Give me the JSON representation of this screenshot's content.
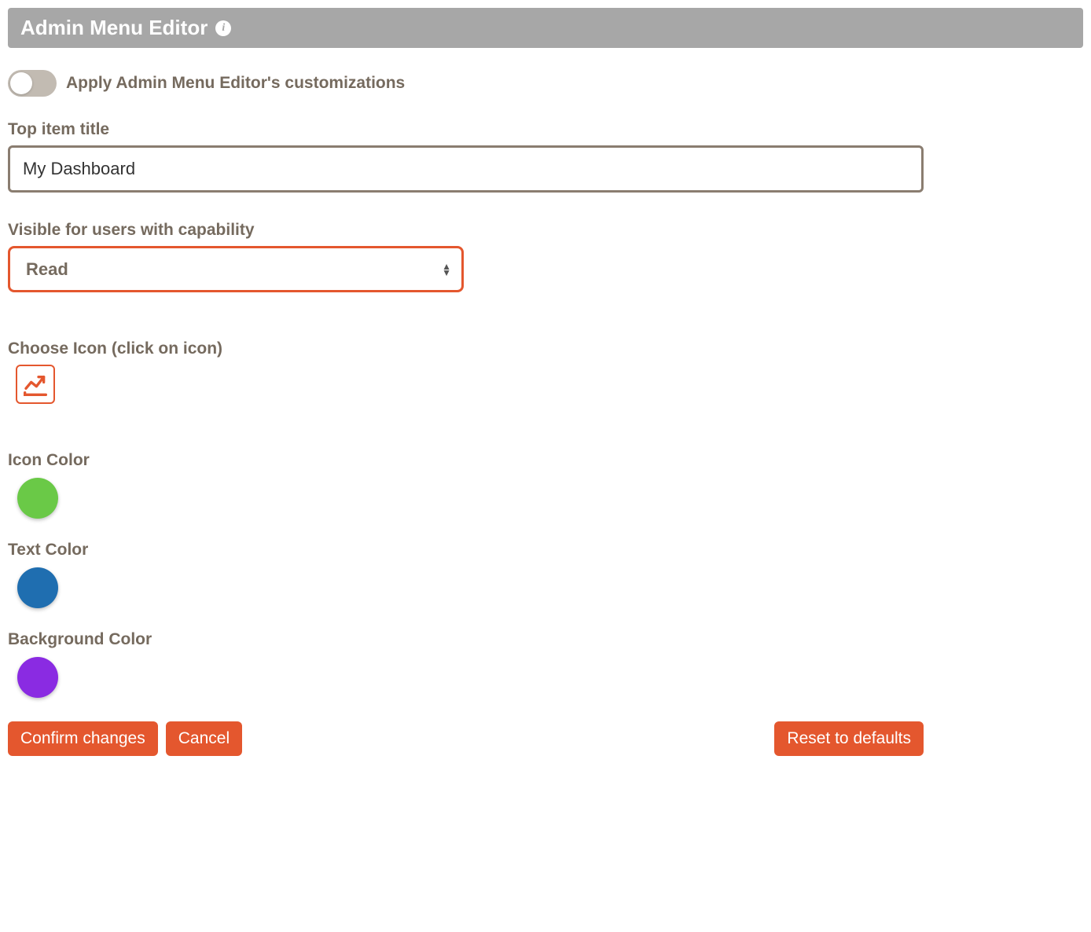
{
  "header": {
    "title": "Admin Menu Editor"
  },
  "toggle": {
    "label": "Apply Admin Menu Editor's customizations",
    "enabled": false
  },
  "fields": {
    "top_item_title": {
      "label": "Top item title",
      "value": "My Dashboard"
    },
    "capability": {
      "label": "Visible for users with capability",
      "selected": "Read"
    },
    "choose_icon": {
      "label": "Choose Icon (click on icon)",
      "icon_name": "chart-line-icon"
    },
    "icon_color": {
      "label": "Icon Color",
      "value": "#6ac947"
    },
    "text_color": {
      "label": "Text Color",
      "value": "#1f6eb0"
    },
    "background_color": {
      "label": "Background Color",
      "value": "#8a2be2"
    }
  },
  "buttons": {
    "confirm": "Confirm changes",
    "cancel": "Cancel",
    "reset": "Reset to defaults"
  }
}
